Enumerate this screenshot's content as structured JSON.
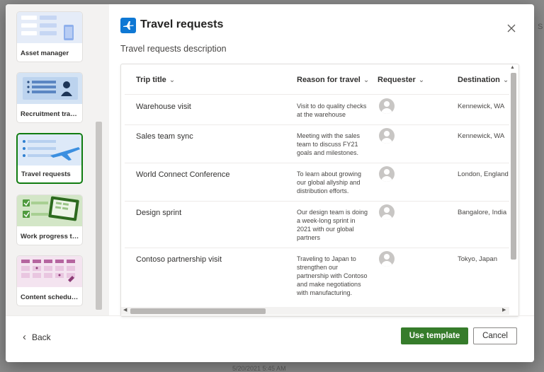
{
  "background": {
    "right_edge_text": "S",
    "bottom_text": "5/20/2021 5:45 AM"
  },
  "dialog": {
    "title": "Travel requests",
    "description": "Travel requests description"
  },
  "templates": [
    {
      "label": "Asset manager"
    },
    {
      "label": "Recruitment tracker"
    },
    {
      "label": "Travel requests",
      "selected": true
    },
    {
      "label": "Work progress tracker"
    },
    {
      "label": "Content scheduler"
    }
  ],
  "preview": {
    "columns": [
      {
        "label": "Trip title"
      },
      {
        "label": "Reason for travel"
      },
      {
        "label": "Requester"
      },
      {
        "label": "Destination"
      }
    ],
    "rows": [
      {
        "title": "Warehouse visit",
        "reason": "Visit to do quality checks at the warehouse",
        "destination": "Kennewick, WA"
      },
      {
        "title": "Sales team sync",
        "reason": "Meeting with the sales team to discuss FY21 goals and milestones.",
        "destination": "Kennewick, WA"
      },
      {
        "title": "World Connect Conference",
        "reason": "To learn about growing our global allyship and distribution efforts.",
        "destination": "London, England"
      },
      {
        "title": "Design sprint",
        "reason": "Our design team is doing a week-long sprint in 2021 with our global partners",
        "destination": "Bangalore, India"
      },
      {
        "title": "Contoso partnership visit",
        "reason": "Traveling to Japan to strengthen our partnership with Contoso and make negotiations with manufacturing.",
        "destination": "Tokyo, Japan"
      }
    ]
  },
  "footer": {
    "back_label": "Back",
    "use_template_label": "Use template",
    "cancel_label": "Cancel"
  },
  "colors": {
    "accent_green": "#367c2b",
    "icon_blue": "#0f78d4",
    "selected_border": "#107c10"
  },
  "icons": {
    "header": "airplane-icon",
    "close": "close-icon",
    "back": "chevron-left-icon",
    "sort": "chevron-down-icon",
    "avatar": "person-icon"
  }
}
